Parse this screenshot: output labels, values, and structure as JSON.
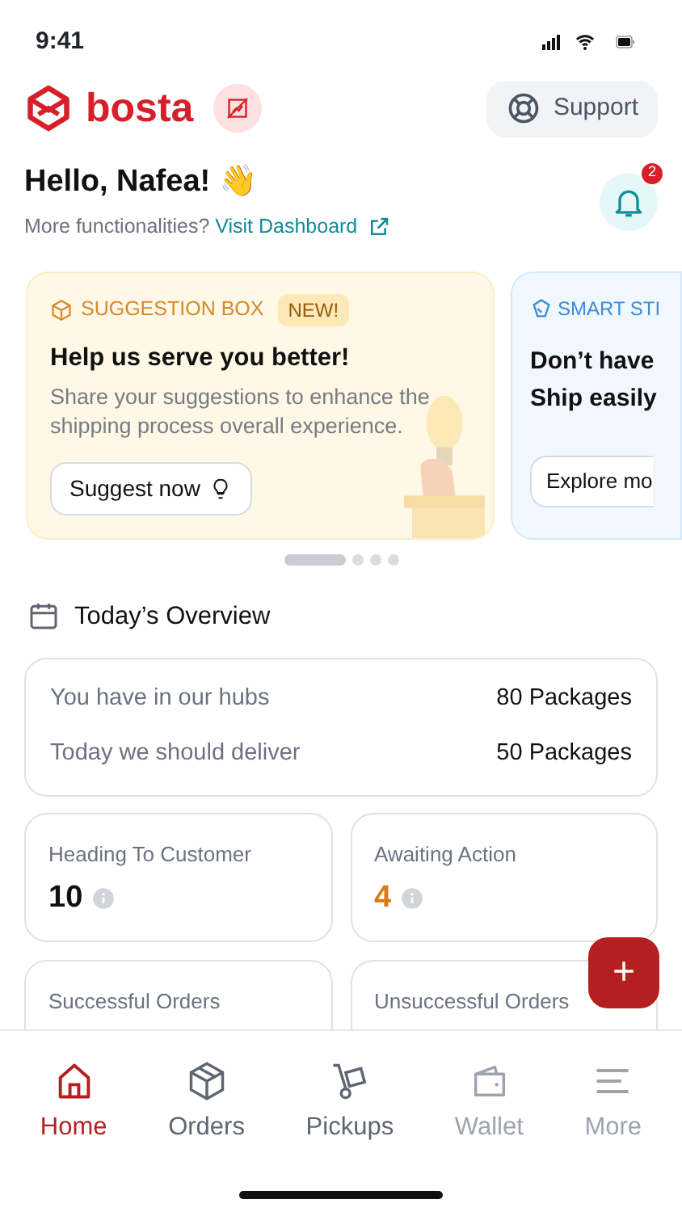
{
  "status_bar": {
    "time": "9:41"
  },
  "header": {
    "logo_text": "bosta",
    "support_label": "Support"
  },
  "greeting": {
    "title": "Hello, Nafea! 👋",
    "prompt": "More functionalities?",
    "link": "Visit Dashboard",
    "notification_count": "2"
  },
  "carousel": {
    "cards": [
      {
        "kind": "suggestion",
        "tag": "SUGGESTION BOX",
        "badge": "NEW!",
        "title": "Help us serve you better!",
        "body": "Share your suggestions to enhance the shipping process overall experience.",
        "button": "Suggest now"
      },
      {
        "kind": "smart",
        "tag": "SMART STI",
        "title_lines": [
          "Don’t have",
          "Ship easily"
        ],
        "button": "Explore mo"
      }
    ],
    "dots": [
      {
        "selected": true
      },
      {
        "selected": false
      },
      {
        "selected": false
      },
      {
        "selected": false
      }
    ]
  },
  "overview": {
    "title": "Today’s Overview",
    "summary": [
      {
        "label": "You have in our hubs",
        "value": "80 Packages"
      },
      {
        "label": "Today we should deliver",
        "value": "50 Packages"
      }
    ],
    "stats": [
      {
        "label": "Heading To Customer",
        "value": "10",
        "color": "#111111"
      },
      {
        "label": "Awaiting Action",
        "value": "4",
        "color": "#d97a14"
      },
      {
        "label": "Successful Orders"
      },
      {
        "label": "Unsuccessful Orders"
      }
    ]
  },
  "fab": {
    "label": "+"
  },
  "tab_bar": [
    {
      "label": "Home",
      "selected": true,
      "disabled": false
    },
    {
      "label": "Orders",
      "selected": false,
      "disabled": false
    },
    {
      "label": "Pickups",
      "selected": false,
      "disabled": false
    },
    {
      "label": "Wallet",
      "selected": false,
      "disabled": true
    },
    {
      "label": "More",
      "selected": false,
      "disabled": true
    }
  ]
}
